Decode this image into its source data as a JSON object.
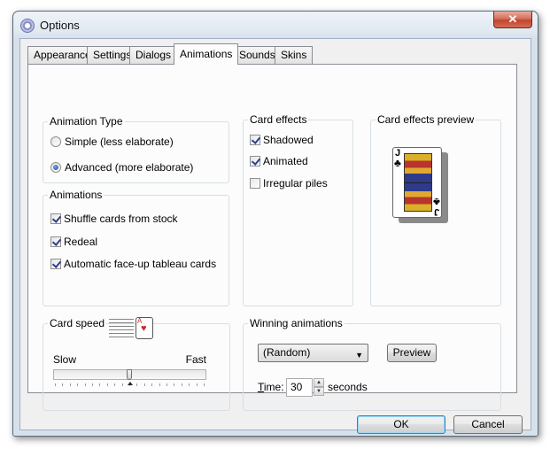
{
  "window": {
    "title": "Options",
    "close_glyph": "✕",
    "icon": "options-gear-icon"
  },
  "tabs": [
    {
      "label": "Appearance",
      "active": false
    },
    {
      "label": "Settings",
      "active": false
    },
    {
      "label": "Dialogs",
      "active": false
    },
    {
      "label": "Animations",
      "active": true
    },
    {
      "label": "Sounds",
      "active": false
    },
    {
      "label": "Skins",
      "active": false
    }
  ],
  "animation_type": {
    "label": "Animation Type",
    "options": [
      {
        "label": "Simple (less elaborate)",
        "selected": false
      },
      {
        "label": "Advanced (more elaborate)",
        "selected": true
      }
    ]
  },
  "animations": {
    "label": "Animations",
    "items": [
      {
        "label": "Shuffle cards from stock",
        "checked": true
      },
      {
        "label": "Redeal",
        "checked": true
      },
      {
        "label": "Automatic face-up tableau cards",
        "checked": true
      }
    ]
  },
  "card_effects": {
    "label": "Card effects",
    "items": [
      {
        "label": "Shadowed",
        "checked": true
      },
      {
        "label": "Animated",
        "checked": true
      },
      {
        "label": "Irregular piles",
        "checked": false
      }
    ]
  },
  "preview": {
    "label": "Card effects preview",
    "card_rank": "J",
    "card_suit": "♣"
  },
  "card_speed": {
    "label": "Card speed",
    "min_label": "Slow",
    "max_label": "Fast",
    "value_fraction": 0.5,
    "mini_card_suit": "♥"
  },
  "winning": {
    "label": "Winning animations",
    "selected": "(Random)",
    "preview_label": "Preview",
    "time_label": "Time:",
    "time_value": "30",
    "time_unit": "seconds"
  },
  "footer": {
    "ok_label": "OK",
    "cancel_label": "Cancel"
  },
  "colors": {
    "accent": "#3c7fb1",
    "close": "#c3442c",
    "card_red": "#cc2a2a"
  }
}
